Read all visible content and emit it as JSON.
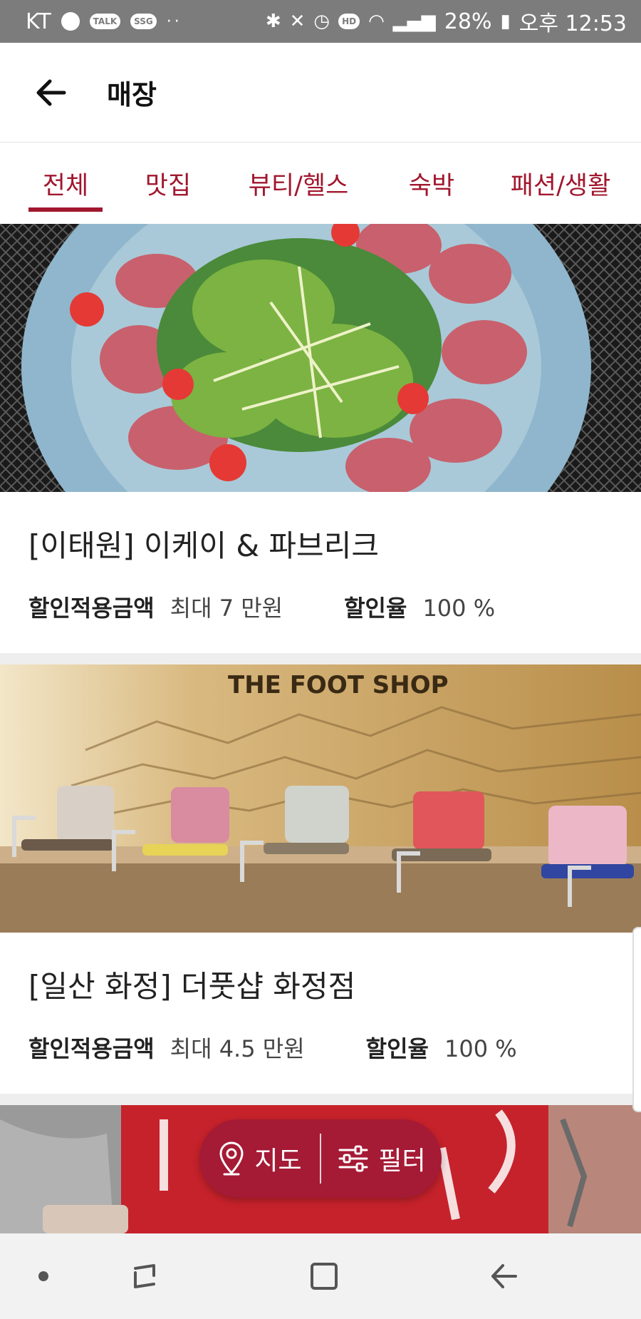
{
  "status_bar": {
    "carrier": "KT",
    "talk_badge": "TALK",
    "ssg_badge": "SSG",
    "dots": "··",
    "hd_badge": "HD",
    "battery": "28%",
    "time": "오후 12:53"
  },
  "header": {
    "title": "매장"
  },
  "tabs": [
    {
      "label": "전체",
      "active": true
    },
    {
      "label": "맛집",
      "active": false
    },
    {
      "label": "뷰티/헬스",
      "active": false
    },
    {
      "label": "숙박",
      "active": false
    },
    {
      "label": "패션/생활",
      "active": false
    }
  ],
  "stores": [
    {
      "name": "[이태원] 이케이 & 파브리크",
      "discount_label": "할인적용금액",
      "discount_value": "최대 7 만원",
      "rate_label": "할인율",
      "rate_value": "100 %"
    },
    {
      "name": "[일산 화정] 더풋샵 화정점",
      "discount_label": "할인적용금액",
      "discount_value": "최대 4.5 만원",
      "rate_label": "할인율",
      "rate_value": "100 %",
      "image_sign": "THE FOOT SHOP"
    }
  ],
  "float_button": {
    "map_label": "지도",
    "filter_label": "필터"
  },
  "colors": {
    "accent": "#a0172e",
    "status_bar": "#7c7c7c",
    "float_button": "#a51a35"
  },
  "icons": {
    "back": "arrow-left",
    "map": "map-pin",
    "filter": "sliders",
    "nav_recent": "recent-apps",
    "nav_home": "home",
    "nav_back": "arrow-back"
  }
}
